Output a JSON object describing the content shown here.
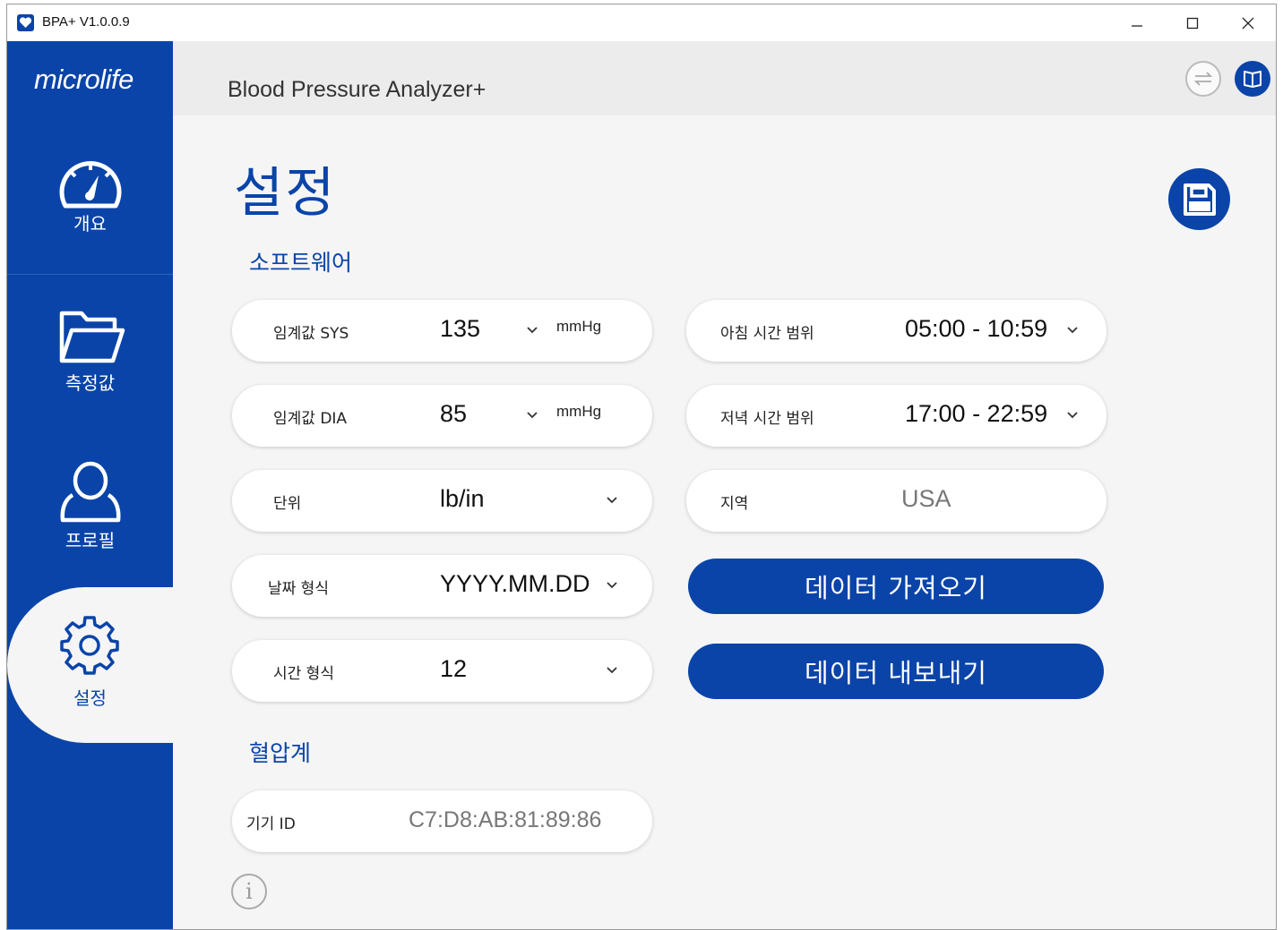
{
  "window": {
    "title": "BPA+ V1.0.0.9"
  },
  "sidebar": {
    "logo": "microlife",
    "items": [
      {
        "label": "개요",
        "icon": "speedometer-icon"
      },
      {
        "label": "측정값",
        "icon": "folder-icon"
      },
      {
        "label": "프로필",
        "icon": "user-icon"
      },
      {
        "label": "설정",
        "icon": "gear-icon",
        "active": true
      }
    ]
  },
  "header": {
    "app_name": "Blood Pressure Analyzer+"
  },
  "page": {
    "title": "설정"
  },
  "software": {
    "title": "소프트웨어",
    "fields": [
      {
        "label": "임계값 SYS",
        "value": "135",
        "unit": "mmHg"
      },
      {
        "label": "임계값 DIA",
        "value": "85",
        "unit": "mmHg"
      },
      {
        "label": "단위",
        "value": "lb/in"
      },
      {
        "label": "날짜 형식",
        "value": "YYYY.MM.DD"
      },
      {
        "label": "시간 형식",
        "value": "12"
      }
    ],
    "time_fields": [
      {
        "label": "아침 시간 범위",
        "value": "05:00 - 10:59"
      },
      {
        "label": "저녁 시간 범위",
        "value": "17:00 - 22:59"
      },
      {
        "label": "지역",
        "value": "USA"
      }
    ],
    "import_label": "데이터 가져오기",
    "export_label": "데이터 내보내기"
  },
  "device": {
    "title": "혈압계",
    "id_label": "기기 ID",
    "id_value": "C7:D8:AB:81:89:86"
  },
  "colors": {
    "brand": "#0a44a8",
    "background": "#f5f5f5"
  }
}
